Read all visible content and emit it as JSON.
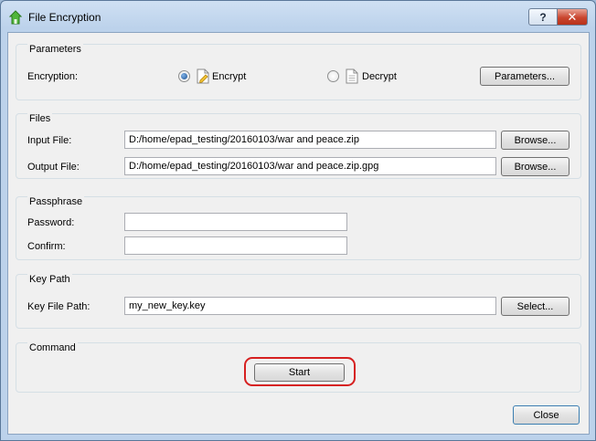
{
  "window": {
    "title": "File Encryption",
    "help_glyph": "?",
    "close_glyph": "✕",
    "app_icon": "green-house-icon"
  },
  "parameters": {
    "title": "Parameters",
    "encryption_label": "Encryption:",
    "encrypt_label": "Encrypt",
    "decrypt_label": "Decrypt",
    "selected": "Encrypt",
    "parameters_button": "Parameters..."
  },
  "files": {
    "title": "Files",
    "input_label": "Input File:",
    "input_value": "D:/home/epad_testing/20160103/war and peace.zip",
    "output_label": "Output File:",
    "output_value": "D:/home/epad_testing/20160103/war and peace.zip.gpg",
    "browse_label": "Browse..."
  },
  "passphrase": {
    "title": "Passphrase",
    "password_label": "Password:",
    "password_value": "",
    "confirm_label": "Confirm:",
    "confirm_value": ""
  },
  "keypath": {
    "title": "Key Path",
    "label": "Key File Path:",
    "value": "my_new_key.key",
    "select_label": "Select..."
  },
  "command": {
    "title": "Command",
    "start_label": "Start"
  },
  "footer": {
    "close_label": "Close"
  },
  "colors": {
    "highlight": "#d62020",
    "titlebar": "#c4d7ee"
  }
}
